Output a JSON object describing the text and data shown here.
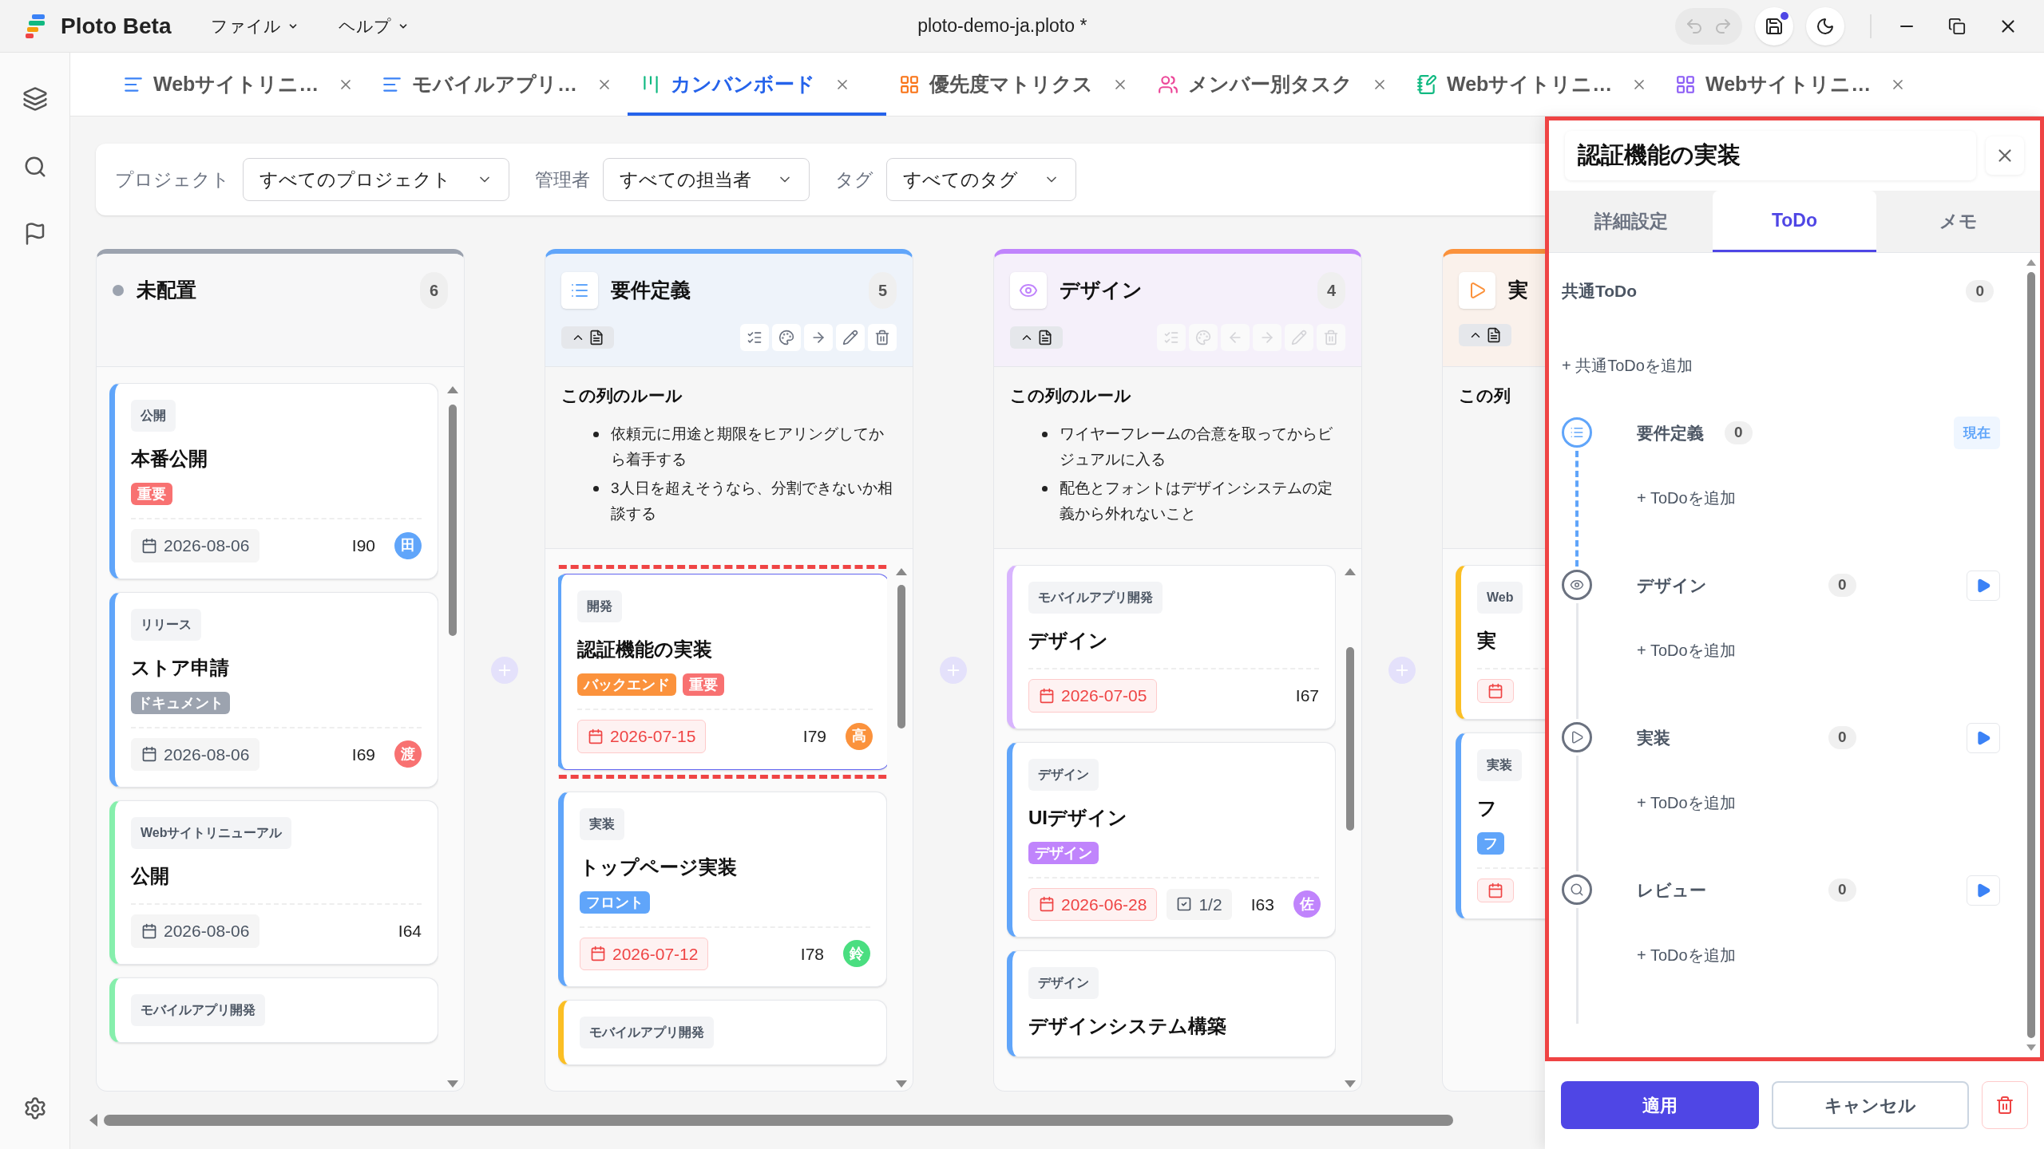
{
  "app": {
    "name": "Ploto Beta",
    "menus": [
      "ファイル",
      "ヘルプ"
    ],
    "file_title": "ploto-demo-ja.ploto *",
    "unsaved": true
  },
  "tabs": [
    {
      "label": "Webサイトリニ…",
      "kind": "doc",
      "color": "#3b82f6",
      "selected": false
    },
    {
      "label": "モバイルアプリ…",
      "kind": "doc",
      "color": "#3b82f6",
      "selected": false
    },
    {
      "label": "カンバンボード",
      "kind": "kanban",
      "color": "#10b981",
      "selected": true
    },
    {
      "label": "優先度マトリクス",
      "kind": "grid",
      "color": "#f97316",
      "selected": false
    },
    {
      "label": "メンバー別タスク",
      "kind": "users",
      "color": "#ec4899",
      "selected": false
    },
    {
      "label": "Webサイトリニ…",
      "kind": "notebook",
      "color": "#10b981",
      "selected": false
    },
    {
      "label": "Webサイトリニ…",
      "kind": "grid",
      "color": "#8b5cf6",
      "selected": false
    }
  ],
  "filters": [
    {
      "label": "プロジェクト",
      "value": "すべてのプロジェクト"
    },
    {
      "label": "管理者",
      "value": "すべての担当者"
    },
    {
      "label": "タグ",
      "value": "すべてのタグ"
    }
  ],
  "columns": [
    {
      "title": "未配置",
      "kind": "dot",
      "color": "#9ca3af",
      "count": "6",
      "toolbar": false,
      "cards": [
        {
          "category": "公開",
          "title": "本番公開",
          "color": "#60a5fa",
          "badges": [
            {
              "label": "重要",
              "color": "#f87171"
            }
          ],
          "date": "2026-08-06",
          "overdue": false,
          "id": "I90",
          "assignee": {
            "initial": "田",
            "color": "#60a5fa"
          }
        },
        {
          "category": "リリース",
          "title": "ストア申請",
          "color": "#60a5fa",
          "badges": [
            {
              "label": "ドキュメント",
              "color": "#9ca3af"
            }
          ],
          "date": "2026-08-06",
          "overdue": false,
          "id": "I69",
          "assignee": {
            "initial": "渡",
            "color": "#f87171"
          }
        },
        {
          "category": "Webサイトリニューアル",
          "title": "公開",
          "color": "#86efac",
          "date": "2026-08-06",
          "overdue": false,
          "id": "I64"
        },
        {
          "category": "モバイルアプリ開発",
          "color": "#86efac"
        }
      ]
    },
    {
      "title": "要件定義",
      "kind": "list",
      "color": "#60a5fa",
      "count": "5",
      "toolbar": true,
      "actions": [
        {
          "kind": "checklist",
          "disabled": false
        },
        {
          "kind": "palette",
          "disabled": false
        },
        {
          "kind": "right",
          "disabled": false
        },
        {
          "kind": "edit",
          "disabled": false
        },
        {
          "kind": "delete",
          "disabled": false
        }
      ],
      "rules_title": "この列のルール",
      "rules": [
        "依頼元に用途と期限をヒアリングしてから着手する",
        "3人日を超えそうなら、分割できないか相談する"
      ],
      "cards": [
        {
          "category": "開発",
          "title": "認証機能の実装",
          "color": "#60a5fa",
          "selected": true,
          "badges": [
            {
              "label": "バックエンド",
              "color": "#fb923c"
            },
            {
              "label": "重要",
              "color": "#f87171"
            }
          ],
          "date": "2026-07-15",
          "overdue": true,
          "id": "I79",
          "assignee": {
            "initial": "高",
            "color": "#fb923c"
          }
        },
        {
          "category": "実装",
          "title": "トップページ実装",
          "color": "#60a5fa",
          "selected": false,
          "badges": [
            {
              "label": "フロント",
              "color": "#60a5fa"
            }
          ],
          "date": "2026-07-12",
          "overdue": true,
          "id": "I78",
          "assignee": {
            "initial": "鈴",
            "color": "#4ade80"
          }
        },
        {
          "category": "モバイルアプリ開発",
          "color": "#fbbf24",
          "selected": false
        }
      ]
    },
    {
      "title": "デザイン",
      "kind": "eye",
      "color": "#c084fc",
      "count": "4",
      "toolbar": true,
      "actions": [
        {
          "kind": "checklist",
          "disabled": true
        },
        {
          "kind": "palette",
          "disabled": true
        },
        {
          "kind": "left",
          "disabled": true
        },
        {
          "kind": "right",
          "disabled": true
        },
        {
          "kind": "edit",
          "disabled": true
        },
        {
          "kind": "delete",
          "disabled": true
        }
      ],
      "rules_title": "この列のルール",
      "rules": [
        "ワイヤーフレームの合意を取ってからビジュアルに入る",
        "配色とフォントはデザインシステムの定義から外れないこと"
      ],
      "cards": [
        {
          "category": "モバイルアプリ開発",
          "title": "デザイン",
          "color": "#d8b4fe",
          "date": "2026-07-05",
          "overdue": true,
          "id": "I67"
        },
        {
          "category": "デザイン",
          "title": "UIデザイン",
          "color": "#60a5fa",
          "badges": [
            {
              "label": "デザイン",
              "color": "#c084fc"
            }
          ],
          "date": "2026-06-28",
          "overdue": true,
          "checklist": "1/2",
          "id": "I63",
          "assignee": {
            "initial": "佐",
            "color": "#c084fc"
          }
        },
        {
          "category": "デザイン",
          "title": "デザインシステム構築",
          "color": "#60a5fa"
        }
      ]
    },
    {
      "title": "実",
      "kind": "play",
      "color": "#fb923c",
      "toolbar": true,
      "rules_title": "この列",
      "cards": [
        {
          "category": "Web",
          "title": "実",
          "color": "#fbbf24",
          "overdue": true
        },
        {
          "category": "実装",
          "title": "フ",
          "color": "#60a5fa",
          "badges": [
            {
              "label": "フ",
              "color": "#60a5fa"
            }
          ],
          "overdue": true
        }
      ]
    }
  ],
  "panel": {
    "title": "認証機能の実装",
    "highlighted": true,
    "tabs": [
      {
        "label": "詳細設定",
        "selected": false
      },
      {
        "label": "ToDo",
        "selected": true
      },
      {
        "label": "メモ",
        "selected": false
      }
    ],
    "common": {
      "label": "共通ToDo",
      "count": "0",
      "add": "+ 共通ToDoを追加"
    },
    "stages": [
      {
        "name": "要件定義",
        "kind": "list",
        "count": "0",
        "current": true,
        "badge": "現在",
        "add": "+ ToDoを追加"
      },
      {
        "name": "デザイン",
        "kind": "eye",
        "count": "0",
        "current": false,
        "add": "+ ToDoを追加"
      },
      {
        "name": "実装",
        "kind": "play",
        "count": "0",
        "current": false,
        "add": "+ ToDoを追加"
      },
      {
        "name": "レビュー",
        "kind": "search",
        "count": "0",
        "current": false,
        "add": "+ ToDoを追加"
      }
    ],
    "apply": "適用",
    "cancel": "キャンセル"
  }
}
